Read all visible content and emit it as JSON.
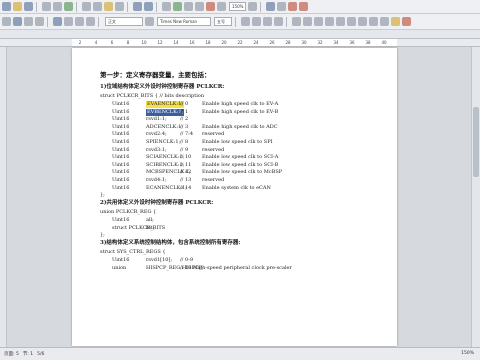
{
  "toolbar": {
    "font_name": "Times New Roman",
    "style_name": "正文",
    "font_size": "五号",
    "zoom_combo": "150%"
  },
  "ruler": {
    "numbers": [
      "2",
      "4",
      "6",
      "8",
      "10",
      "12",
      "14",
      "16",
      "18",
      "20",
      "22",
      "24",
      "26",
      "28",
      "30",
      "32",
      "34",
      "36",
      "38",
      "40"
    ]
  },
  "document": {
    "heading": "第一步：定义寄存器变量，主要包括：",
    "section1": "1)位域结构体定义外设时钟控制寄存器 PCLKCR:",
    "struct_open": "struct PCLKCR_BITS   {           // bits   description",
    "rows": [
      {
        "type": "Uint16",
        "field": "EVAENCLK:1;",
        "cmt": "// 0",
        "desc": "Enable high speed clk to EV-A",
        "hl": "yellow"
      },
      {
        "type": "Uint16",
        "field": "EVBENCLK:1;",
        "cmt": "// 1",
        "desc": "Enable high speed clk to EV-B",
        "hl": "select"
      },
      {
        "type": "Uint16",
        "field": "rsvd1:1;",
        "cmt": "// 2",
        "desc": "",
        "hl": ""
      },
      {
        "type": "Uint16",
        "field": "ADCENCLK:1;",
        "cmt": "// 3",
        "desc": "Enable high speed clk to ADC",
        "hl": ""
      },
      {
        "type": "Uint16",
        "field": "rsvd2:4;",
        "cmt": "// 7:4",
        "desc": "reserved",
        "hl": ""
      },
      {
        "type": "Uint16",
        "field": "SPIENCLK:1;",
        "cmt": "// 8",
        "desc": "Enable low speed clk to SPI",
        "hl": ""
      },
      {
        "type": "Uint16",
        "field": "rsvd3:1;",
        "cmt": "// 9",
        "desc": "reserved",
        "hl": ""
      },
      {
        "type": "Uint16",
        "field": "SCIAENCLK:1;",
        "cmt": "// 10",
        "desc": "Enable low speed clk to SCI-A",
        "hl": ""
      },
      {
        "type": "Uint16",
        "field": "SCIBENCLK:1;",
        "cmt": "// 11",
        "desc": "Enable low speed clk to SCI-B",
        "hl": ""
      },
      {
        "type": "Uint16",
        "field": "MCBSPENCLK:1;",
        "cmt": "// 12",
        "desc": "Enable low speed clk to McBSP",
        "hl": ""
      },
      {
        "type": "Uint16",
        "field": "rsvd4:1;",
        "cmt": "// 13",
        "desc": "reserved",
        "hl": ""
      },
      {
        "type": "Uint16",
        "field": "ECANENCLK:1;",
        "cmt": "// 14",
        "desc": "Enable system clk to eCAN",
        "hl": ""
      }
    ],
    "struct_close": "};",
    "section2": "2)共用体定义外设时钟控制寄存器 PCLKCR:",
    "union_open": "union PCLKCR_REG {",
    "union_rows": [
      {
        "type": "Uint16",
        "field": "all;"
      },
      {
        "type": "struct PCLKCR_BITS",
        "field": "bit;"
      }
    ],
    "union_close": "};",
    "section3": "3)结构体定义系统控制结构体，包含系统控制所有寄存器:",
    "struct2_open": "struct SYS_CTRL_REGS {",
    "struct2_rows": [
      {
        "type": "Uint16",
        "field": "rsvd1[10];",
        "cmt": "// 0-9"
      },
      {
        "type": "union",
        "field": "HISPCP_REG HISPCP;",
        "cmt": "// 10 High-speed peripheral clock pre-scaler"
      }
    ]
  },
  "status": {
    "page": "页面: 5",
    "section": "节: 1",
    "pages": "5/6",
    "zoom": "150%"
  }
}
